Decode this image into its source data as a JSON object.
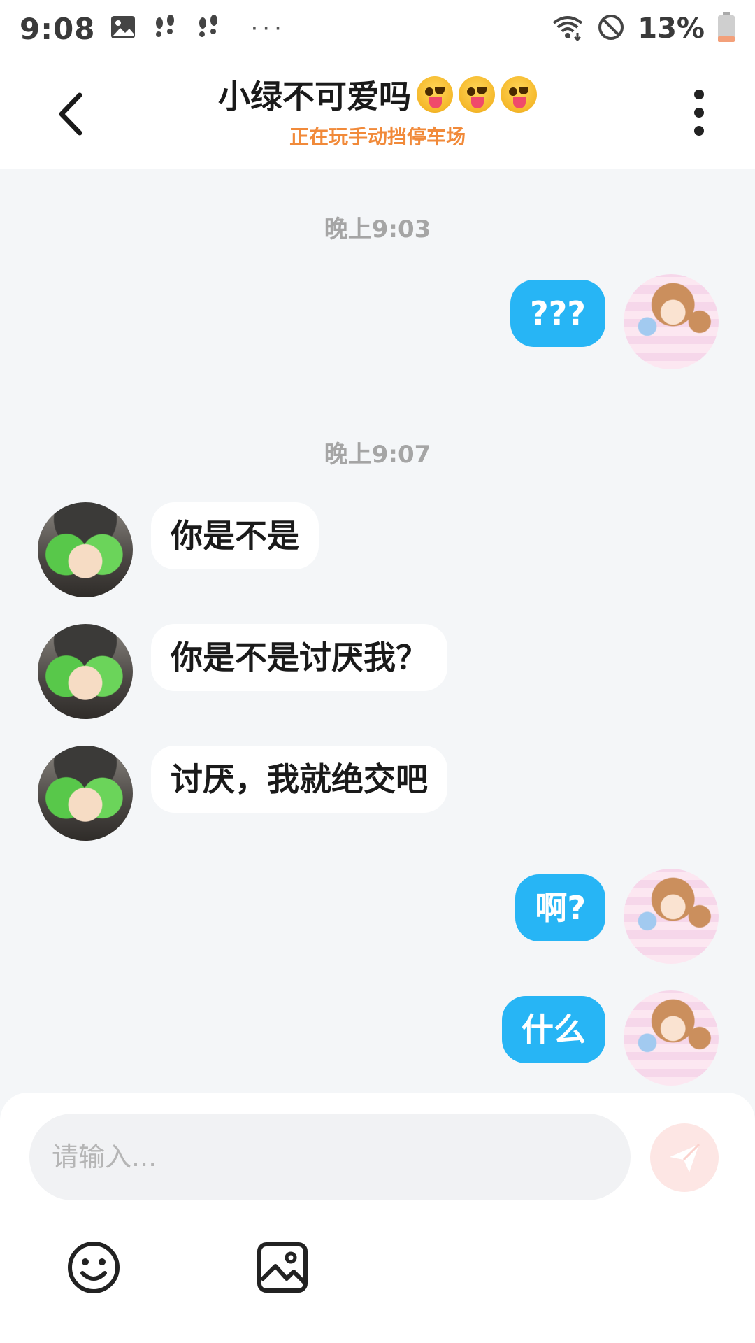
{
  "status_bar": {
    "time": "9:08",
    "battery_percent": "13%",
    "more_dots": "···"
  },
  "header": {
    "title": "小绿不可爱吗",
    "title_emojis": [
      "squinting-tongue-emoji",
      "squinting-tongue-emoji",
      "squinting-tongue-emoji"
    ],
    "subtitle": "正在玩手动挡停车场"
  },
  "chat": {
    "timestamps": [
      "晚上9:03",
      "晚上9:07"
    ],
    "messages": [
      {
        "side": "out",
        "text": "???"
      },
      {
        "side": "in",
        "text": "你是不是"
      },
      {
        "side": "in",
        "text": "你是不是讨厌我？"
      },
      {
        "side": "in",
        "text": "讨厌，我就绝交吧"
      },
      {
        "side": "out",
        "text": "啊?"
      },
      {
        "side": "out",
        "text": "什么"
      }
    ]
  },
  "composer": {
    "placeholder": "请输入...",
    "value": ""
  },
  "colors": {
    "accent": "#27b5f5",
    "subtitle": "#f18a3a",
    "chat_background": "#f4f6f8",
    "send_button": "#fde6e4"
  }
}
